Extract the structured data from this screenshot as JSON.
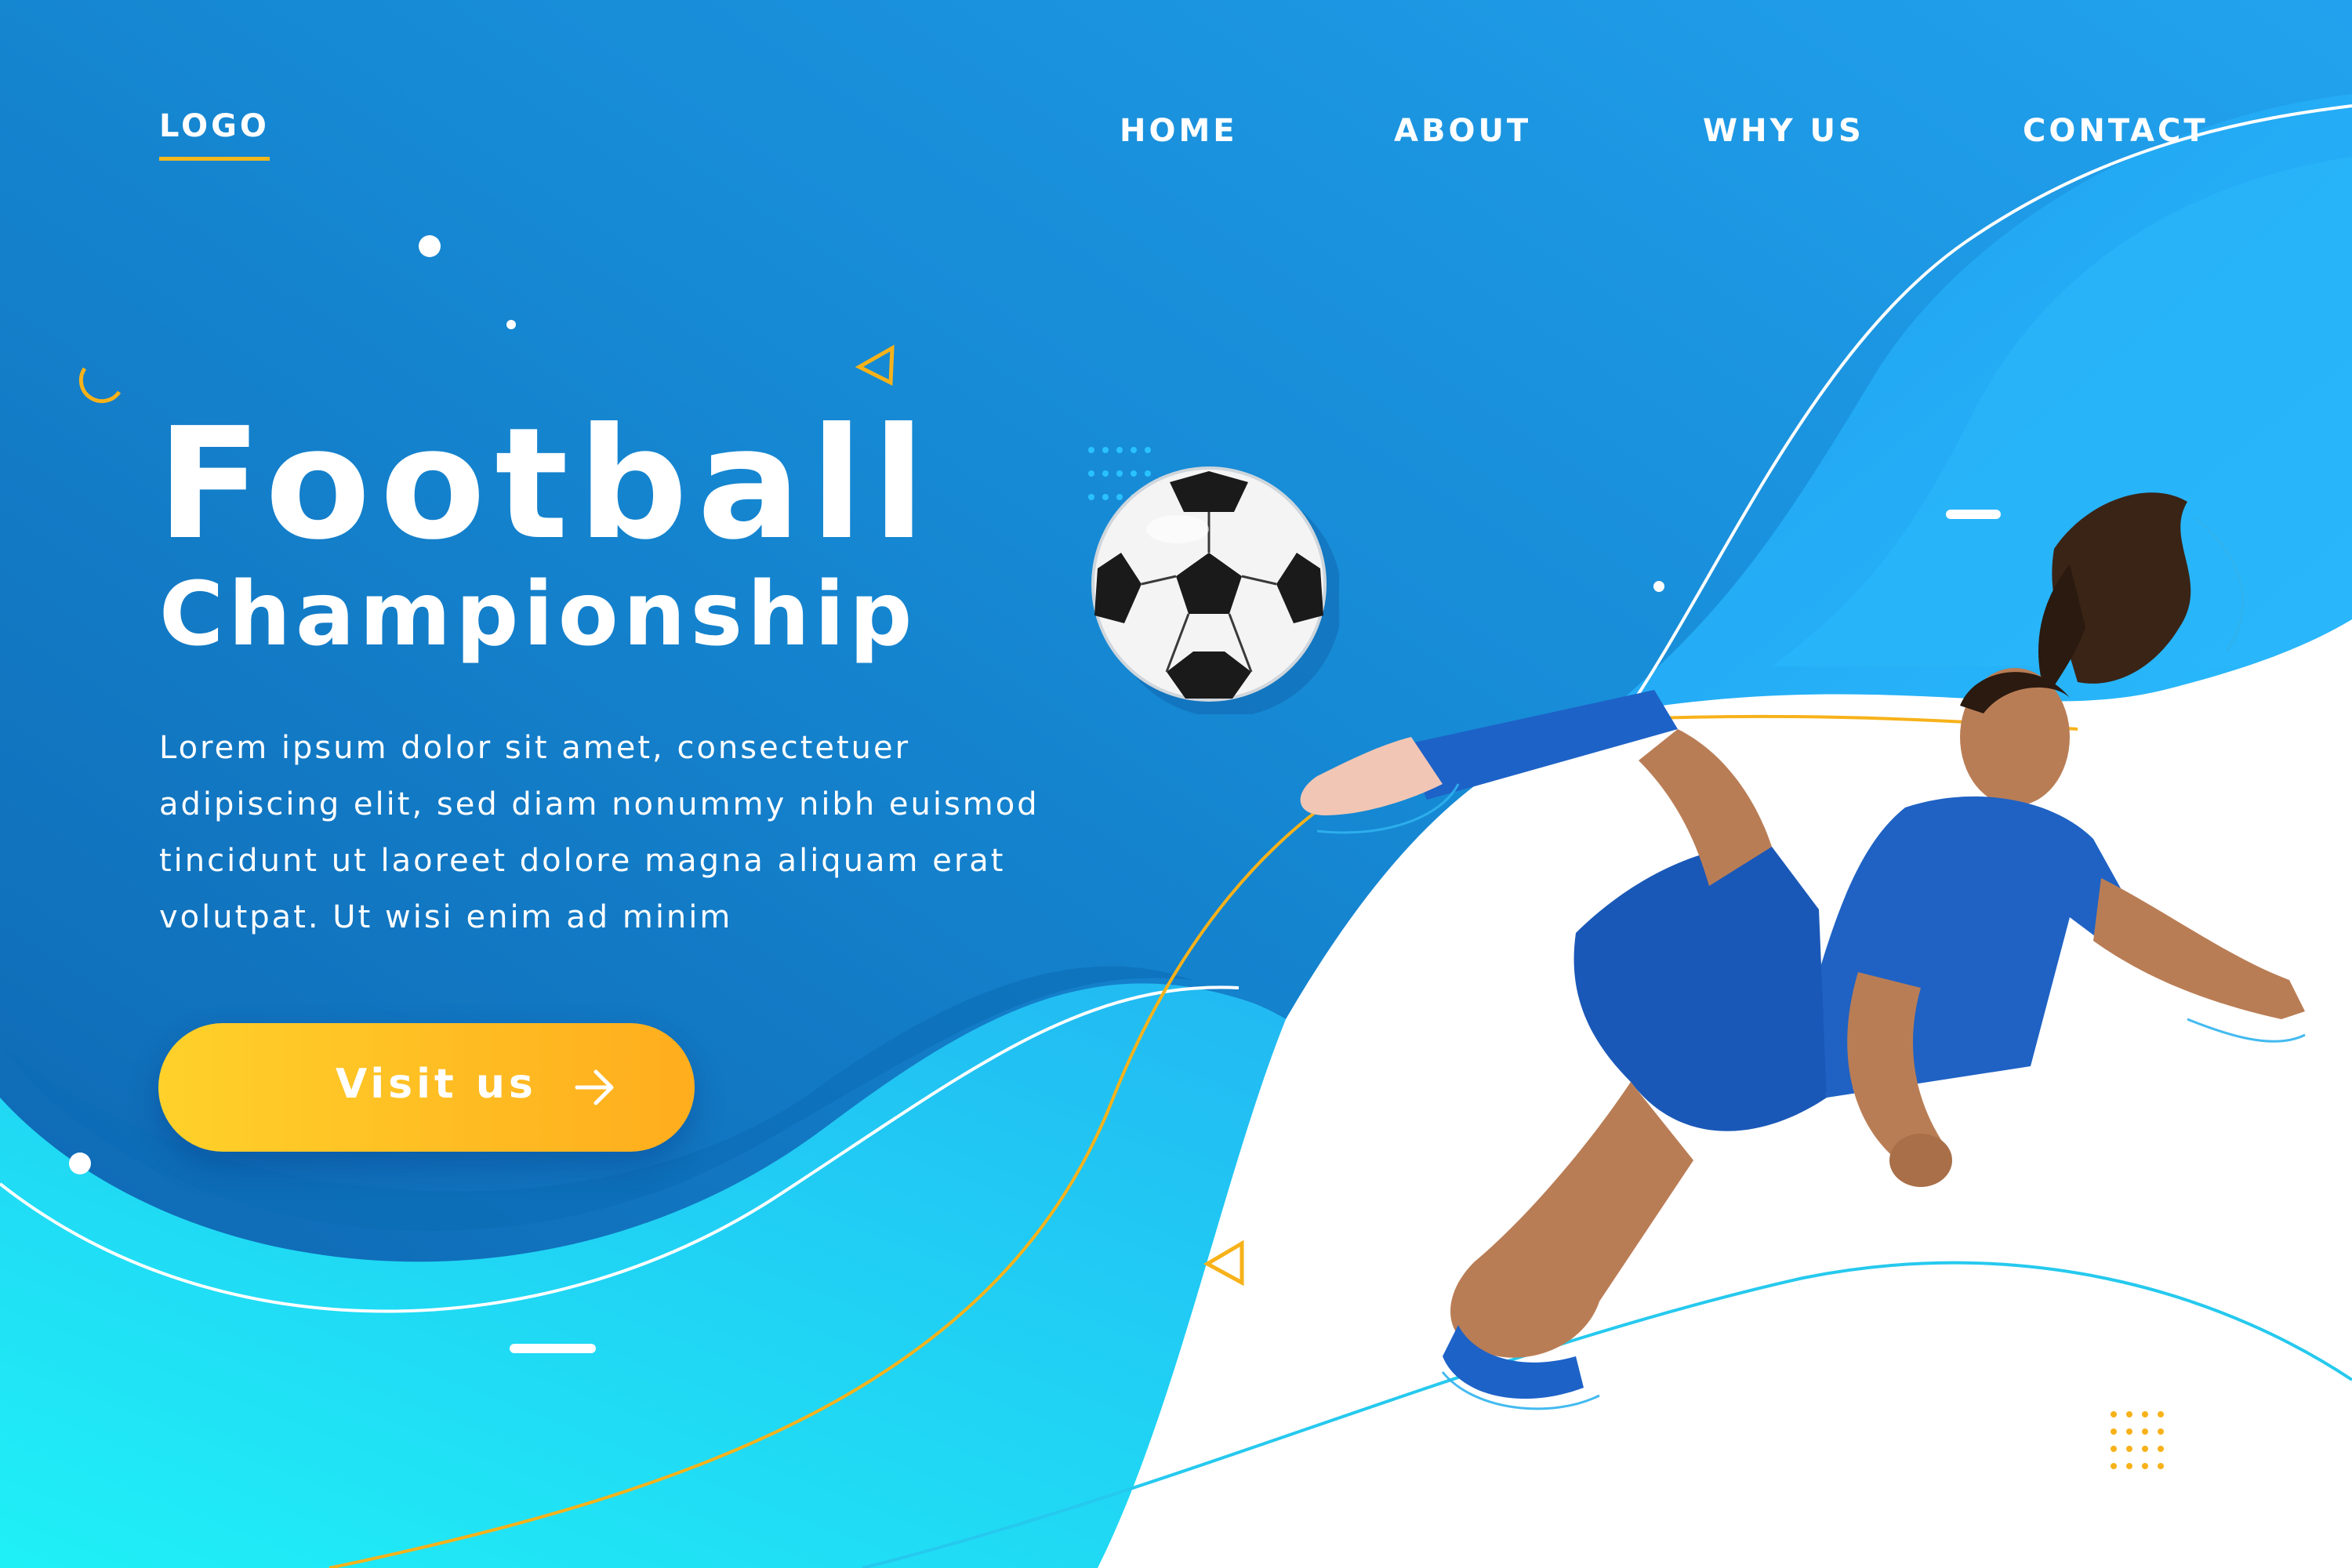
{
  "logo": {
    "label": "LOGO"
  },
  "nav": {
    "items": [
      {
        "label": "HOME"
      },
      {
        "label": "ABOUT"
      },
      {
        "label": "WHY US"
      },
      {
        "label": "CONTACT"
      }
    ]
  },
  "hero": {
    "title": "Football",
    "subtitle": "Championship",
    "description": "Lorem ipsum dolor sit amet, consectetuer adipiscing elit, sed diam nonummy nibh euismod tincidunt ut laoreet dolore magna aliquam erat volutpat. Ut wisi enim ad minim",
    "cta_label": "Visit us",
    "cta_icon": "arrow-right-icon"
  },
  "colors": {
    "deep_blue": "#0f74c0",
    "sky_blue": "#20a8f2",
    "cyan": "#20e6f6",
    "accent_yellow": "#ffc21f",
    "white": "#ffffff"
  },
  "images": {
    "ball": "soccer-ball",
    "player": "female-football-player-kicking"
  }
}
